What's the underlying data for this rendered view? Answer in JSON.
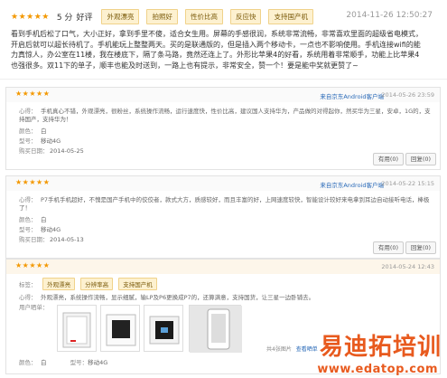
{
  "review1": {
    "stars": "★★★★★",
    "score": "5 分",
    "rating_word": "好评",
    "tags": [
      "外观漂亮",
      "拍照好",
      "性价比高",
      "反应快",
      "支持国产机"
    ],
    "date": "2014-11-26 12:50:27",
    "body": "看到手机后松了口气，大小正好，拿到手里不傻，适合女生用。屏幕的手感很润，系统非常流畅，非常喜欢里面的超级省电模式，开启后就可以超长待机了。手机能玩上整整两天。买的是联通版的，但是插入两个移动卡，一点也不影响使用。手机连接wifi的能力真惊人，办公室在11楼，我在楼底下，隔了条马路，竟然还连上了。外形比苹果4的好看，系统用着非常顺手，功能上比苹果4也强很多。双11下的单子，顺丰也能及时送到，一路上也有提示，非常安全，赞一个！要是能中奖就更赞了~"
  },
  "review2": {
    "stars": "★★★★★",
    "client": "来自京东Android客户端",
    "date": "2014-05-26 23:59",
    "rows": [
      {
        "label": "心得：",
        "value": "手机真心不错，外观漂亮，很粉丝，系统操作流畅，运行速度快，性价比高，建议国人支持华为，产品做的对得起你，然买华为三星，安卓，1G的，支持国产，支持华为！"
      },
      {
        "label": "颜色：",
        "value": "白"
      },
      {
        "label": "型号：",
        "value": "移动4G"
      },
      {
        "label": "购买日期：",
        "value": "2014-05-25"
      }
    ],
    "useful": "有用(0)",
    "reply": "回复(0)"
  },
  "review3": {
    "stars": "★★★★★",
    "client": "来自京东Android客户端",
    "date": "2014-05-22 15:15",
    "rows": [
      {
        "label": "心得：",
        "value": "P7手机手机超好，不愧是国产手机中的佼佼者，款式大方，质感较好，而且丰富的好，上网速度较快，智能设计较好来电拿到耳边自动接听电话，棒极了！"
      },
      {
        "label": "颜色：",
        "value": "白"
      },
      {
        "label": "型号：",
        "value": "移动4G"
      },
      {
        "label": "购买日期：",
        "value": "2014-05-13"
      }
    ],
    "useful": "有用(0)",
    "reply": "回复(0)"
  },
  "review4": {
    "stars": "★★★★★",
    "date": "2014-05-24 12:43",
    "tag_label": "标签：",
    "tags": [
      "外观漂亮",
      "分辨率高",
      "支持国产机"
    ],
    "experience_label": "心得：",
    "experience": "外观漂亮，系统操作流畅，显示细腻，输LP及P6更换成P7的，还算满意，支持国货，让三星一边卧铺去。",
    "photos_label": "用户晒单：",
    "photo_count": "共4张图片",
    "view_link": "查看晒单",
    "color_label": "颜色：",
    "color": "白",
    "model_label": "型号：",
    "model": "移动4G"
  },
  "watermark": {
    "brand": "易迪拓培训",
    "url": "www.edatop.com"
  }
}
